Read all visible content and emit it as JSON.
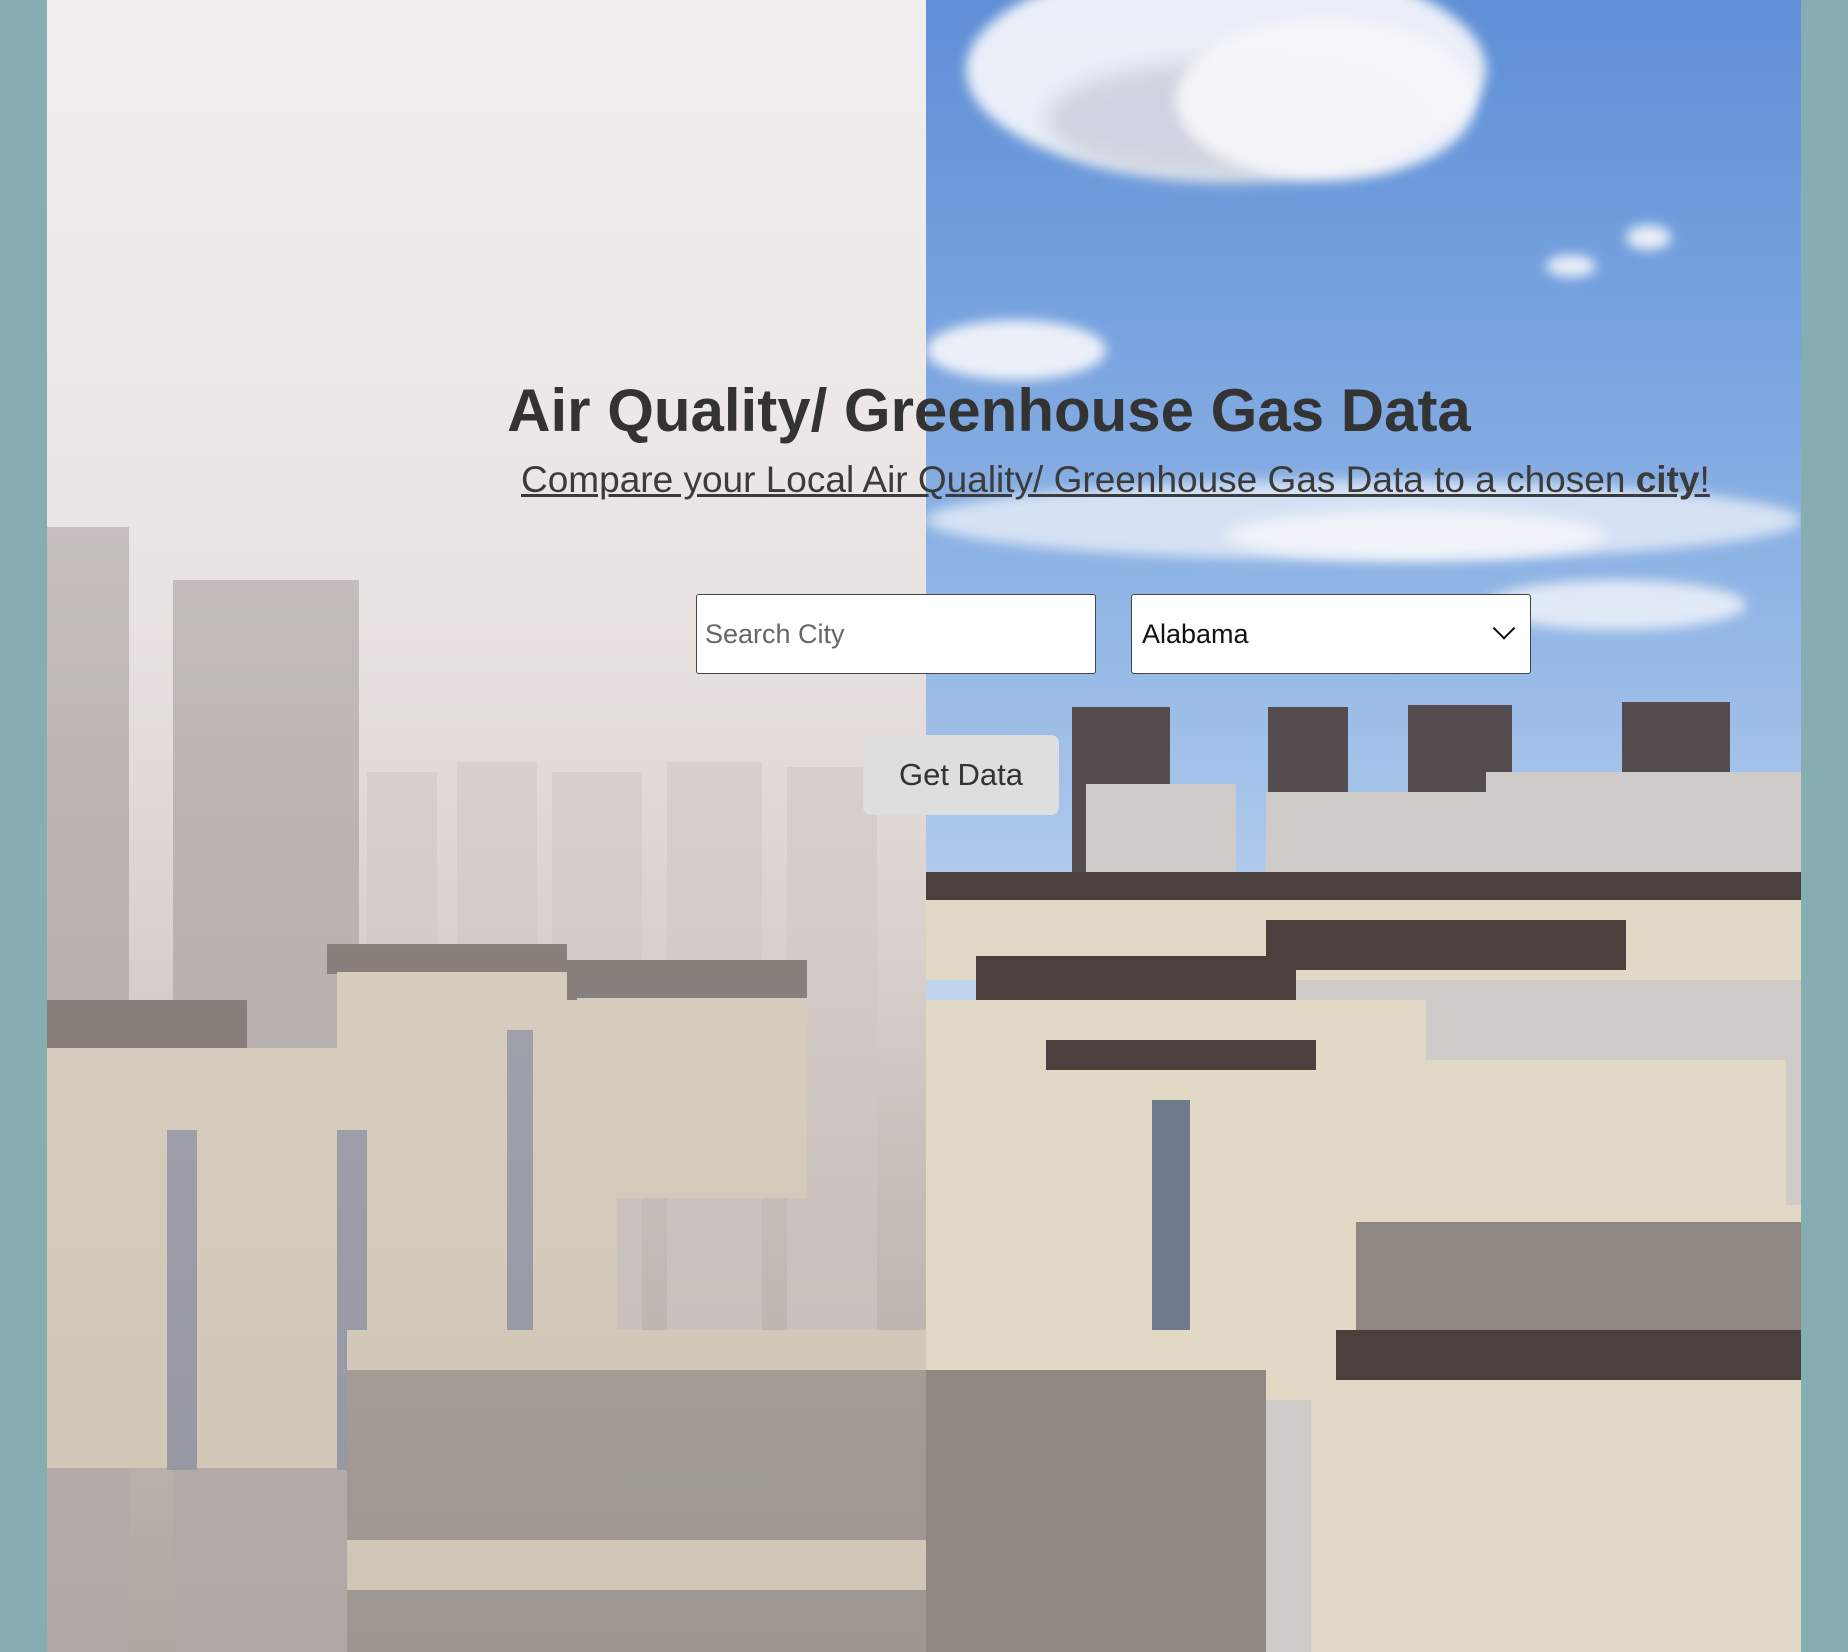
{
  "page": {
    "background_color": "#86adb1",
    "hero_image": "split-city-photo-smog-vs-clear-sky"
  },
  "header": {
    "title": "Air Quality/ Greenhouse Gas Data",
    "subtitle_prefix": "Compare your Local Air Quality/ Greenhouse Gas Data to a chosen ",
    "subtitle_emphasis": "city",
    "subtitle_suffix": "!"
  },
  "form": {
    "search_placeholder": "Search City",
    "state_selected": "Alabama",
    "submit_label": "Get Data"
  },
  "colors": {
    "title_text": "#333333",
    "button_bg": "#dedede",
    "input_border": "#444444"
  }
}
